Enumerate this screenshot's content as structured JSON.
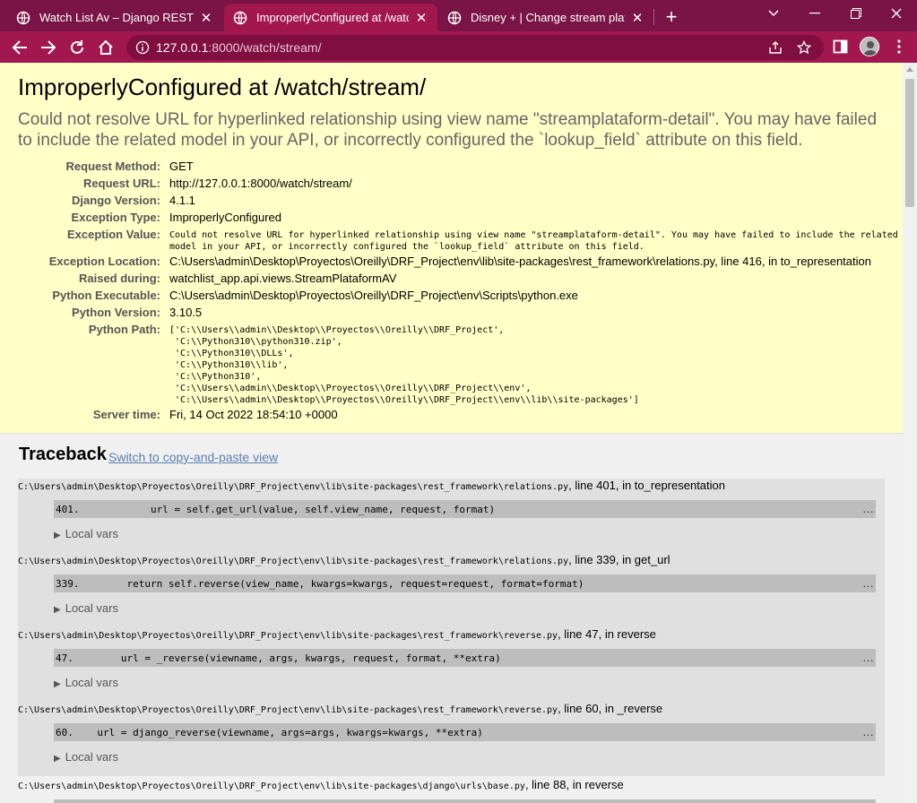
{
  "browser": {
    "tabs": [
      {
        "title": "Watch List Av – Django REST framework",
        "active": false
      },
      {
        "title": "ImproperlyConfigured at /watch/stream/",
        "active": true
      },
      {
        "title": "Disney + | Change stream plataform",
        "active": false
      }
    ],
    "url_host": "127.0.0.1",
    "url_rest": ":8000/watch/stream/",
    "accent": "#a3174f",
    "tabbar_color": "#7a1446"
  },
  "error": {
    "title": "ImproperlyConfigured at /watch/stream/",
    "message": "Could not resolve URL for hyperlinked relationship using view name \"streamplataform-detail\". You may have failed to include the related model in your API, or incorrectly configured the `lookup_field` attribute on this field.",
    "meta": [
      {
        "key": "Request Method:",
        "value": "GET"
      },
      {
        "key": "Request URL:",
        "value": "http://127.0.0.1:8000/watch/stream/"
      },
      {
        "key": "Django Version:",
        "value": "4.1.1"
      },
      {
        "key": "Exception Type:",
        "value": "ImproperlyConfigured"
      },
      {
        "key": "Exception Value:",
        "value": "Could not resolve URL for hyperlinked relationship using view name \"streamplataform-detail\". You may have failed to include the related\nmodel in your API, or incorrectly configured the `lookup_field` attribute on this field."
      },
      {
        "key": "Exception Location:",
        "value": "C:\\Users\\admin\\Desktop\\Proyectos\\Oreilly\\DRF_Project\\env\\lib\\site-packages\\rest_framework\\relations.py, line 416, in to_representation"
      },
      {
        "key": "Raised during:",
        "value": "watchlist_app.api.views.StreamPlataformAV"
      },
      {
        "key": "Python Executable:",
        "value": "C:\\Users\\admin\\Desktop\\Proyectos\\Oreilly\\DRF_Project\\env\\Scripts\\python.exe"
      },
      {
        "key": "Python Version:",
        "value": "3.10.5"
      },
      {
        "key": "Python Path:",
        "value": "['C:\\\\Users\\\\admin\\\\Desktop\\\\Proyectos\\\\Oreilly\\\\DRF_Project',\n 'C:\\\\Python310\\\\python310.zip',\n 'C:\\\\Python310\\\\DLLs',\n 'C:\\\\Python310\\\\lib',\n 'C:\\\\Python310',\n 'C:\\\\Users\\\\admin\\\\Desktop\\\\Proyectos\\\\Oreilly\\\\DRF_Project\\\\env',\n 'C:\\\\Users\\\\admin\\\\Desktop\\\\Proyectos\\\\Oreilly\\\\DRF_Project\\\\env\\\\lib\\\\site-packages']"
      },
      {
        "key": "Server time:",
        "value": "Fri, 14 Oct 2022 18:54:10 +0000"
      }
    ]
  },
  "traceback": {
    "title": "Traceback",
    "switch_label": "Switch to copy-and-paste view",
    "local_vars_label": "Local vars",
    "frames": [
      {
        "path": "C:\\Users\\admin\\Desktop\\Proyectos\\Oreilly\\DRF_Project\\env\\lib\\site-packages\\rest_framework\\relations.py",
        "where": ", line 401, in to_representation",
        "code": "401.            url = self.get_url(value, self.view_name, request, format)"
      },
      {
        "path": "C:\\Users\\admin\\Desktop\\Proyectos\\Oreilly\\DRF_Project\\env\\lib\\site-packages\\rest_framework\\relations.py",
        "where": ", line 339, in get_url",
        "code": "339.        return self.reverse(view_name, kwargs=kwargs, request=request, format=format)"
      },
      {
        "path": "C:\\Users\\admin\\Desktop\\Proyectos\\Oreilly\\DRF_Project\\env\\lib\\site-packages\\rest_framework\\reverse.py",
        "where": ", line 47, in reverse",
        "code": "47.        url = _reverse(viewname, args, kwargs, request, format, **extra)"
      },
      {
        "path": "C:\\Users\\admin\\Desktop\\Proyectos\\Oreilly\\DRF_Project\\env\\lib\\site-packages\\rest_framework\\reverse.py",
        "where": ", line 60, in _reverse",
        "code": "60.    url = django_reverse(viewname, args=args, kwargs=kwargs, **extra)"
      }
    ],
    "last_frame": {
      "path": "C:\\Users\\admin\\Desktop\\Proyectos\\Oreilly\\DRF_Project\\env\\lib\\site-packages\\django\\urls\\base.py",
      "where": ", line 88, in reverse"
    }
  }
}
